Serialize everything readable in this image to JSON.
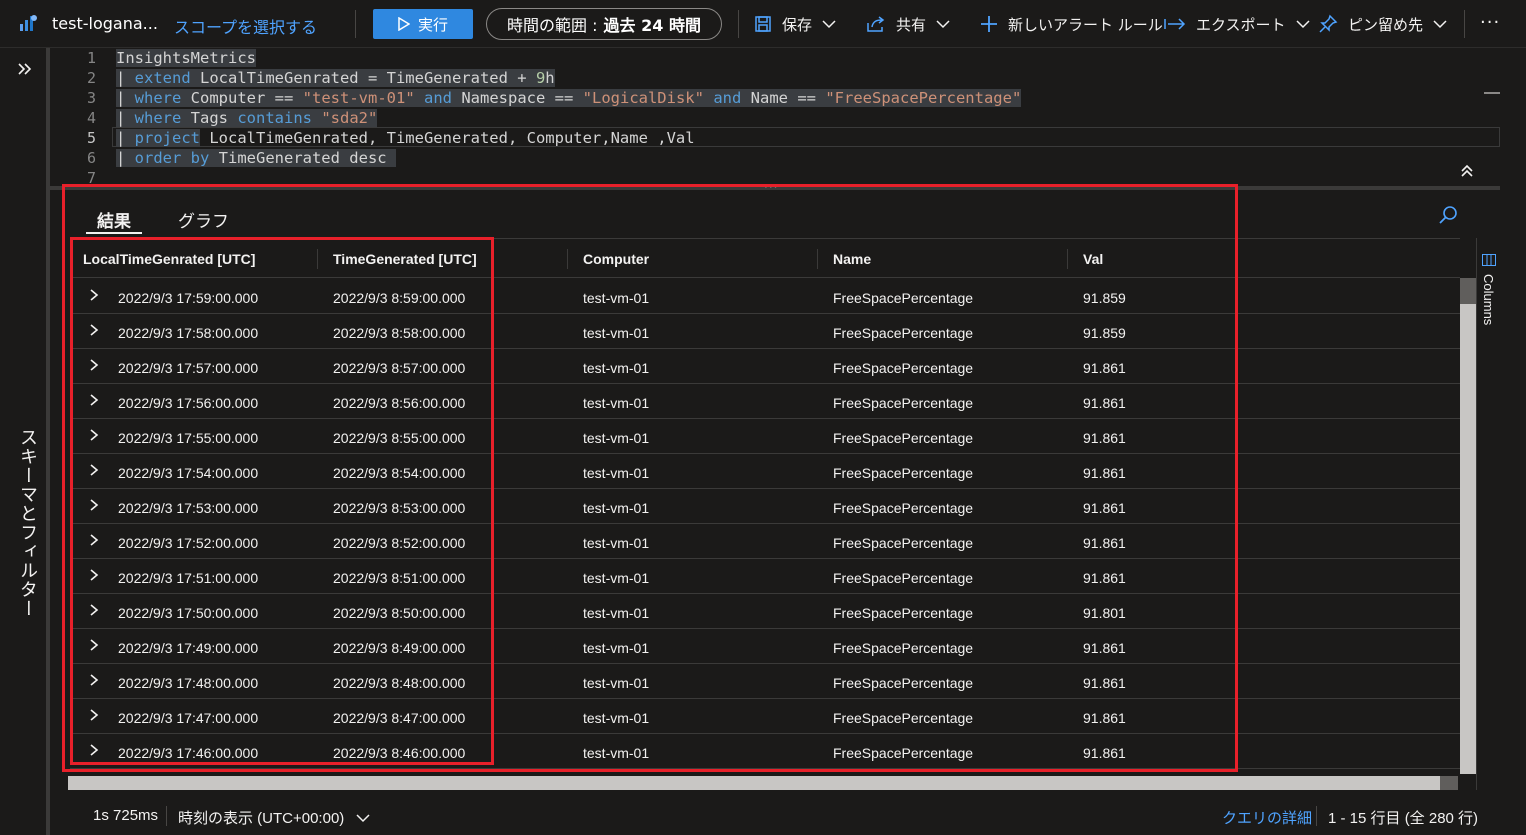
{
  "toolbar": {
    "title": "test-logana...",
    "scope_link": "スコープを選択する",
    "run_label": "実行",
    "time_range_label": "時間の範囲 :",
    "time_range_value": "過去 24 時間",
    "save_label": "保存",
    "share_label": "共有",
    "new_alert_label": "新しいアラート ルール",
    "export_label": "エクスポート",
    "pin_label": "ピン留め先",
    "more_label": "···"
  },
  "left_rail": {
    "expand_icon": "double-chevron-right-icon",
    "label": "スキーマとフィルター"
  },
  "editor": {
    "line_numbers": [
      "1",
      "2",
      "3",
      "4",
      "5",
      "6",
      "7"
    ],
    "lines": [
      "InsightsMetrics",
      "| extend LocalTimeGenrated = TimeGenerated + 9h",
      "| where Computer == \"test-vm-01\" and Namespace == \"LogicalDisk\" and Name == \"FreeSpacePercentage\"",
      "| where Tags contains \"sda2\"",
      "| project LocalTimeGenrated, TimeGenerated, Computer,Name ,Val",
      "| order by TimeGenerated desc",
      ""
    ]
  },
  "results": {
    "tabs": [
      "結果",
      "グラフ"
    ],
    "active_tab": "結果",
    "columns": [
      "LocalTimeGenrated [UTC]",
      "TimeGenerated [UTC]",
      "Computer",
      "Name",
      "Val"
    ],
    "rows": [
      [
        "2022/9/3 17:59:00.000",
        "2022/9/3 8:59:00.000",
        "test-vm-01",
        "FreeSpacePercentage",
        "91.859"
      ],
      [
        "2022/9/3 17:58:00.000",
        "2022/9/3 8:58:00.000",
        "test-vm-01",
        "FreeSpacePercentage",
        "91.859"
      ],
      [
        "2022/9/3 17:57:00.000",
        "2022/9/3 8:57:00.000",
        "test-vm-01",
        "FreeSpacePercentage",
        "91.861"
      ],
      [
        "2022/9/3 17:56:00.000",
        "2022/9/3 8:56:00.000",
        "test-vm-01",
        "FreeSpacePercentage",
        "91.861"
      ],
      [
        "2022/9/3 17:55:00.000",
        "2022/9/3 8:55:00.000",
        "test-vm-01",
        "FreeSpacePercentage",
        "91.861"
      ],
      [
        "2022/9/3 17:54:00.000",
        "2022/9/3 8:54:00.000",
        "test-vm-01",
        "FreeSpacePercentage",
        "91.861"
      ],
      [
        "2022/9/3 17:53:00.000",
        "2022/9/3 8:53:00.000",
        "test-vm-01",
        "FreeSpacePercentage",
        "91.861"
      ],
      [
        "2022/9/3 17:52:00.000",
        "2022/9/3 8:52:00.000",
        "test-vm-01",
        "FreeSpacePercentage",
        "91.861"
      ],
      [
        "2022/9/3 17:51:00.000",
        "2022/9/3 8:51:00.000",
        "test-vm-01",
        "FreeSpacePercentage",
        "91.861"
      ],
      [
        "2022/9/3 17:50:00.000",
        "2022/9/3 8:50:00.000",
        "test-vm-01",
        "FreeSpacePercentage",
        "91.801"
      ],
      [
        "2022/9/3 17:49:00.000",
        "2022/9/3 8:49:00.000",
        "test-vm-01",
        "FreeSpacePercentage",
        "91.861"
      ],
      [
        "2022/9/3 17:48:00.000",
        "2022/9/3 8:48:00.000",
        "test-vm-01",
        "FreeSpacePercentage",
        "91.861"
      ],
      [
        "2022/9/3 17:47:00.000",
        "2022/9/3 8:47:00.000",
        "test-vm-01",
        "FreeSpacePercentage",
        "91.861"
      ],
      [
        "2022/9/3 17:46:00.000",
        "2022/9/3 8:46:00.000",
        "test-vm-01",
        "FreeSpacePercentage",
        "91.861"
      ]
    ],
    "columns_panel_label": "Columns"
  },
  "status": {
    "duration": "1s 725ms",
    "time_display": "時刻の表示 (UTC+00:00)",
    "query_details": "クエリの詳細",
    "row_count": "1 - 15 行目 (全 280 行)"
  },
  "colors": {
    "accent": "#2f88e0",
    "link": "#4fa3ff",
    "highlight_box": "#e8202a",
    "background": "#1b1a19"
  }
}
